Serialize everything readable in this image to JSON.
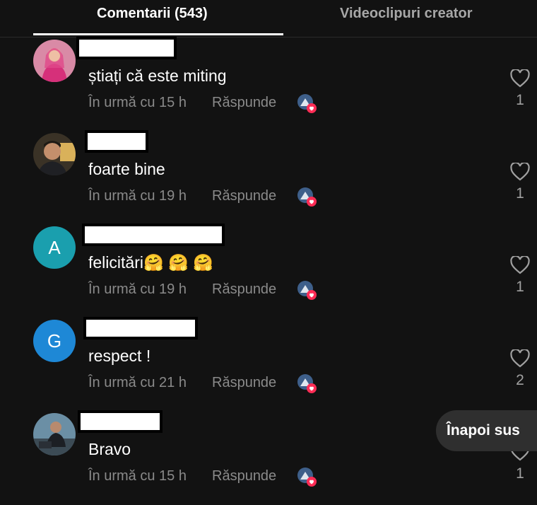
{
  "tabs": {
    "comments": "Comentarii (543)",
    "creator_videos": "Videoclipuri creator"
  },
  "reply_label": "Răspunde",
  "back_to_top": "Înapoi sus",
  "comments": [
    {
      "text": "știați că este miting",
      "time": "În urmă cu 15 h",
      "likes": "1",
      "avatar": "photo"
    },
    {
      "text": "foarte bine",
      "time": "În urmă cu 19 h",
      "likes": "1",
      "avatar": "photo"
    },
    {
      "text": "felicitări🤗 🤗 🤗",
      "time": "În urmă cu 19 h",
      "likes": "1",
      "avatar": "A",
      "avatar_color": "#1a9fae"
    },
    {
      "text": "respect !",
      "time": "În urmă cu 21 h",
      "likes": "2",
      "avatar": "G",
      "avatar_color": "#1e88d6"
    },
    {
      "text": "Bravo",
      "time": "În urmă cu 15 h",
      "likes": "1",
      "avatar": "photo"
    }
  ],
  "colors": {
    "background": "#121212",
    "secondary_text": "#8a8a8a",
    "heart_badge": "#fe2c55"
  }
}
